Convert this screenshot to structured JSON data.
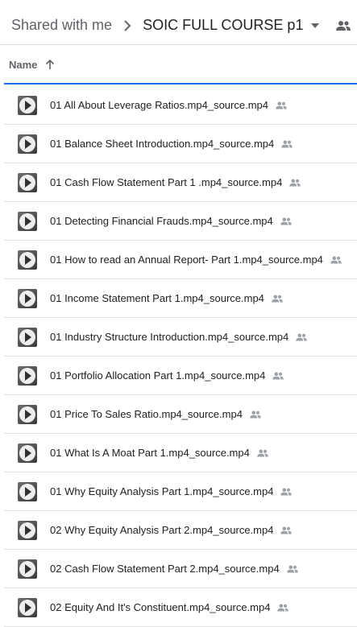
{
  "breadcrumb": {
    "root": "Shared with me",
    "current": "SOIC FULL COURSE p1"
  },
  "column_header": {
    "name": "Name",
    "sort": "ascending"
  },
  "icons": {
    "separator": "chevron-right-icon",
    "dropdown": "caret-down-icon",
    "shared": "people-icon",
    "sort": "arrow-up-icon",
    "file": "video-play-icon"
  },
  "colors": {
    "accent": "#1a73e8",
    "text": "#202124",
    "muted": "#5f6368",
    "icon": "#9aa0a6"
  },
  "files": [
    {
      "name": "01 All About Leverage Ratios.mp4_source.mp4"
    },
    {
      "name": "01 Balance Sheet Introduction.mp4_source.mp4"
    },
    {
      "name": "01 Cash Flow Statement Part 1 .mp4_source.mp4"
    },
    {
      "name": "01 Detecting Financial Frauds.mp4_source.mp4"
    },
    {
      "name": "01 How to read an Annual Report- Part 1.mp4_source.mp4"
    },
    {
      "name": "01 Income Statement Part 1.mp4_source.mp4"
    },
    {
      "name": "01 Industry Structure Introduction.mp4_source.mp4"
    },
    {
      "name": "01 Portfolio Allocation Part 1.mp4_source.mp4"
    },
    {
      "name": "01 Price To Sales Ratio.mp4_source.mp4"
    },
    {
      "name": "01 What Is A Moat Part 1.mp4_source.mp4"
    },
    {
      "name": "01 Why Equity Analysis Part 1.mp4_source.mp4"
    },
    {
      "name": "02  Why Equity Analysis Part 2.mp4_source.mp4"
    },
    {
      "name": "02 Cash Flow Statement Part 2.mp4_source.mp4"
    },
    {
      "name": "02 Equity And It's Constituent.mp4_source.mp4"
    }
  ]
}
